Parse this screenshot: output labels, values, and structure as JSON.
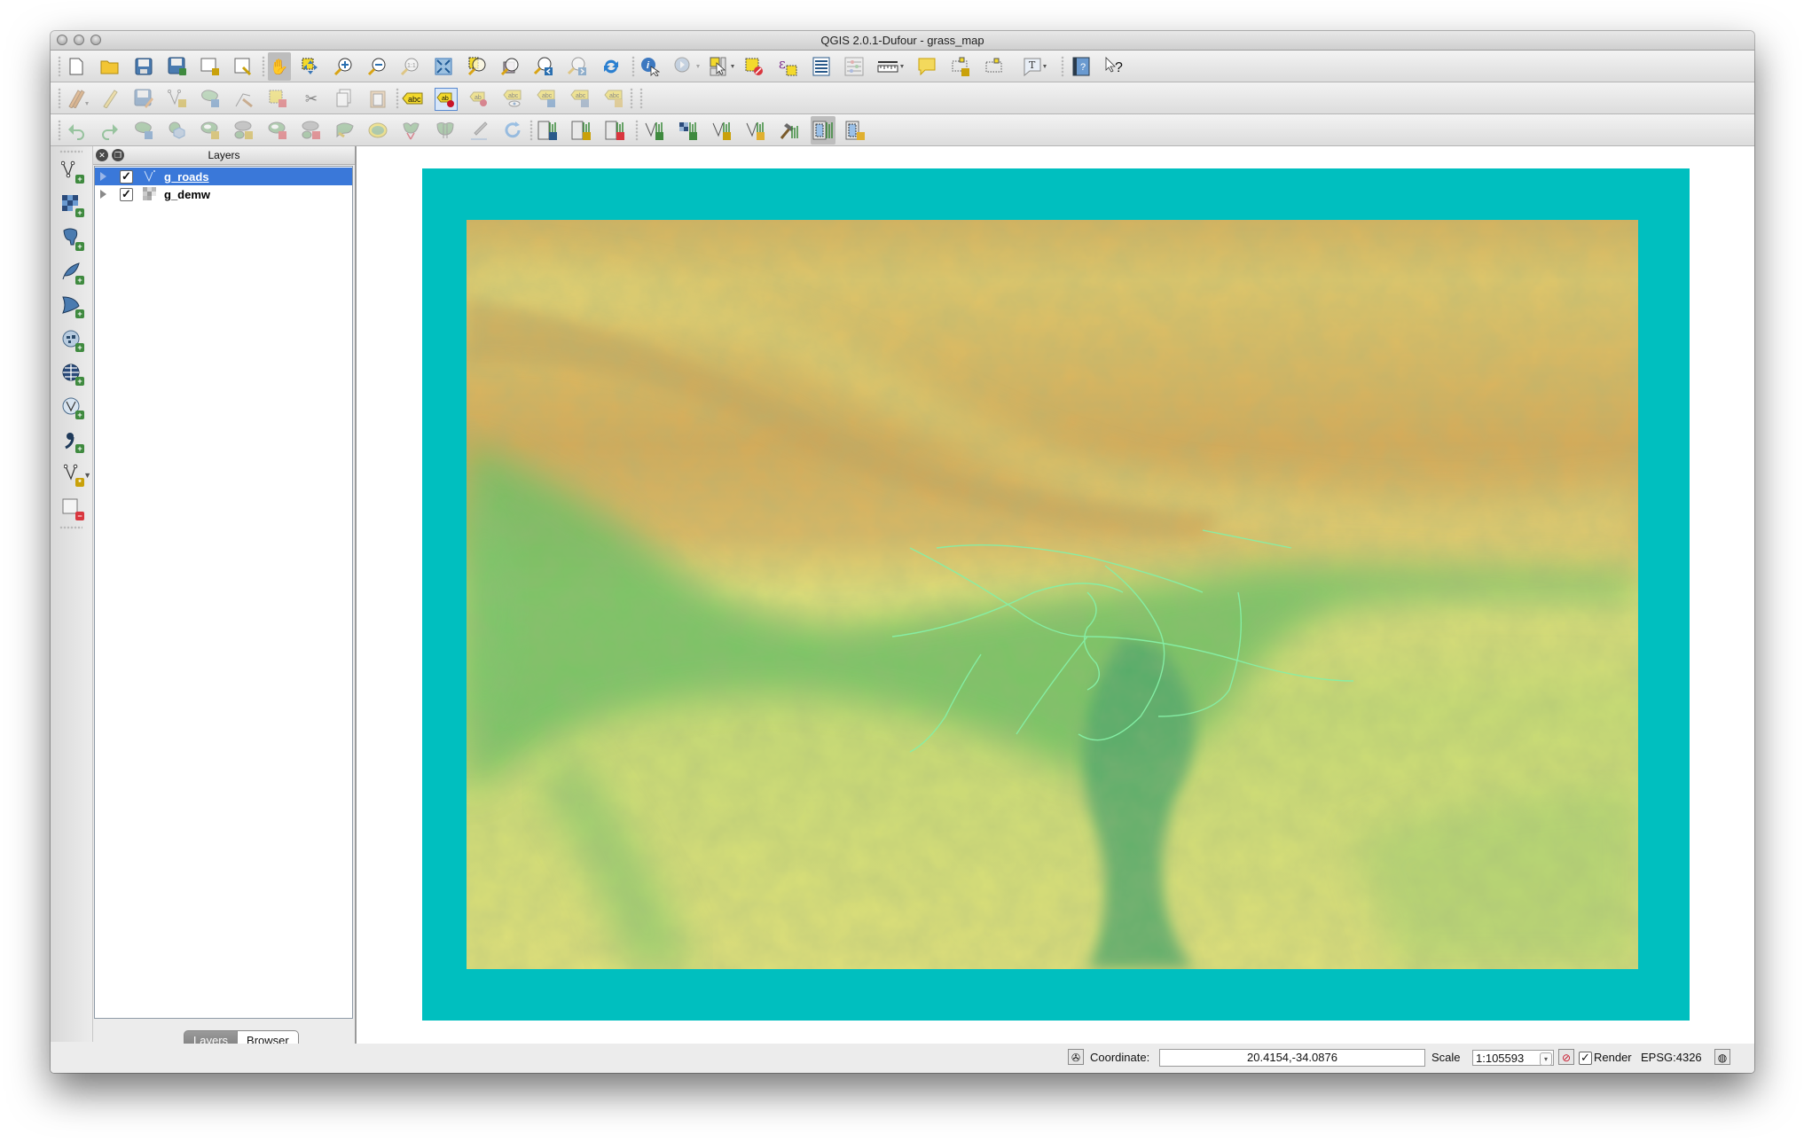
{
  "window": {
    "title": "QGIS 2.0.1-Dufour - grass_map"
  },
  "toolbars": {
    "file": [
      "new-project",
      "open-project",
      "save-project",
      "save-project-as",
      "new-print-composer",
      "composer-manager"
    ],
    "map_navigation": [
      "pan-map",
      "pan-to-selection",
      "zoom-in",
      "zoom-out",
      "zoom-native-resolution",
      "zoom-full",
      "zoom-to-selection",
      "zoom-to-layer",
      "zoom-last",
      "zoom-next",
      "refresh"
    ],
    "attributes": [
      "identify-features",
      "run-feature-action",
      "select-features",
      "deselect-all",
      "select-by-expression",
      "open-attribute-table",
      "field-calculator",
      "measure-line",
      "map-tips",
      "new-bookmark",
      "show-bookmarks",
      "text-annotation"
    ],
    "help": [
      "help-contents",
      "whats-this"
    ],
    "digitizing": [
      "toggle-editing",
      "current-edits",
      "save-layer-edits",
      "add-feature",
      "move-feature",
      "node-tool",
      "delete-selected",
      "cut-features",
      "copy-features",
      "paste-features"
    ],
    "label": [
      "layer-labeling-options",
      "pin-unpin-labels",
      "highlight-pinned-labels",
      "show-hide-labels",
      "move-label",
      "rotate-label",
      "change-label"
    ],
    "advanced_digitizing": [
      "undo",
      "redo",
      "rotate-feature",
      "simplify-feature",
      "add-ring",
      "add-part",
      "delete-ring",
      "delete-part",
      "reshape-features",
      "offset-curve",
      "split-features",
      "merge-attributes",
      "rotate-point-symbols",
      "merge-selected"
    ],
    "grass": [
      "open-grass-mapset",
      "new-grass-mapset",
      "close-grass-mapset",
      "add-grass-vector",
      "add-grass-raster",
      "create-grass-vector",
      "edit-grass-vector",
      "open-grass-tools",
      "display-grass-region",
      "edit-grass-region"
    ]
  },
  "manage_layers": [
    "add-vector-layer",
    "add-raster-layer",
    "add-postgis-layer",
    "add-spatialite-layer",
    "add-mssql-layer",
    "add-wms-layer",
    "add-wcs-layer",
    "add-wfs-layer",
    "add-delimited-text-layer",
    "new-shapefile-layer",
    "remove-layer"
  ],
  "layers_panel": {
    "title": "Layers",
    "layers": [
      {
        "name": "g_roads",
        "type": "vector-line",
        "visible": true,
        "selected": true
      },
      {
        "name": "g_demw",
        "type": "raster",
        "visible": true,
        "selected": false
      }
    ],
    "tabs": [
      {
        "label": "Layers",
        "active": true
      },
      {
        "label": "Browser",
        "active": false
      }
    ]
  },
  "map": {
    "background_color": "#00bfbf",
    "layers_rendered": [
      "g_roads",
      "g_demw"
    ],
    "dem_colors": {
      "low": "#2f9a6a",
      "mid_low": "#6dc26a",
      "mid": "#e2e27a",
      "high": "#d5ac5a"
    },
    "roads_color": "#86f0a6"
  },
  "statusbar": {
    "coordinate_label": "Coordinate:",
    "coordinate_value": "20.4154,-34.0876",
    "scale_label": "Scale",
    "scale_value": "1:105593",
    "render_label": "Render",
    "render_checked": true,
    "crs": "EPSG:4326"
  }
}
